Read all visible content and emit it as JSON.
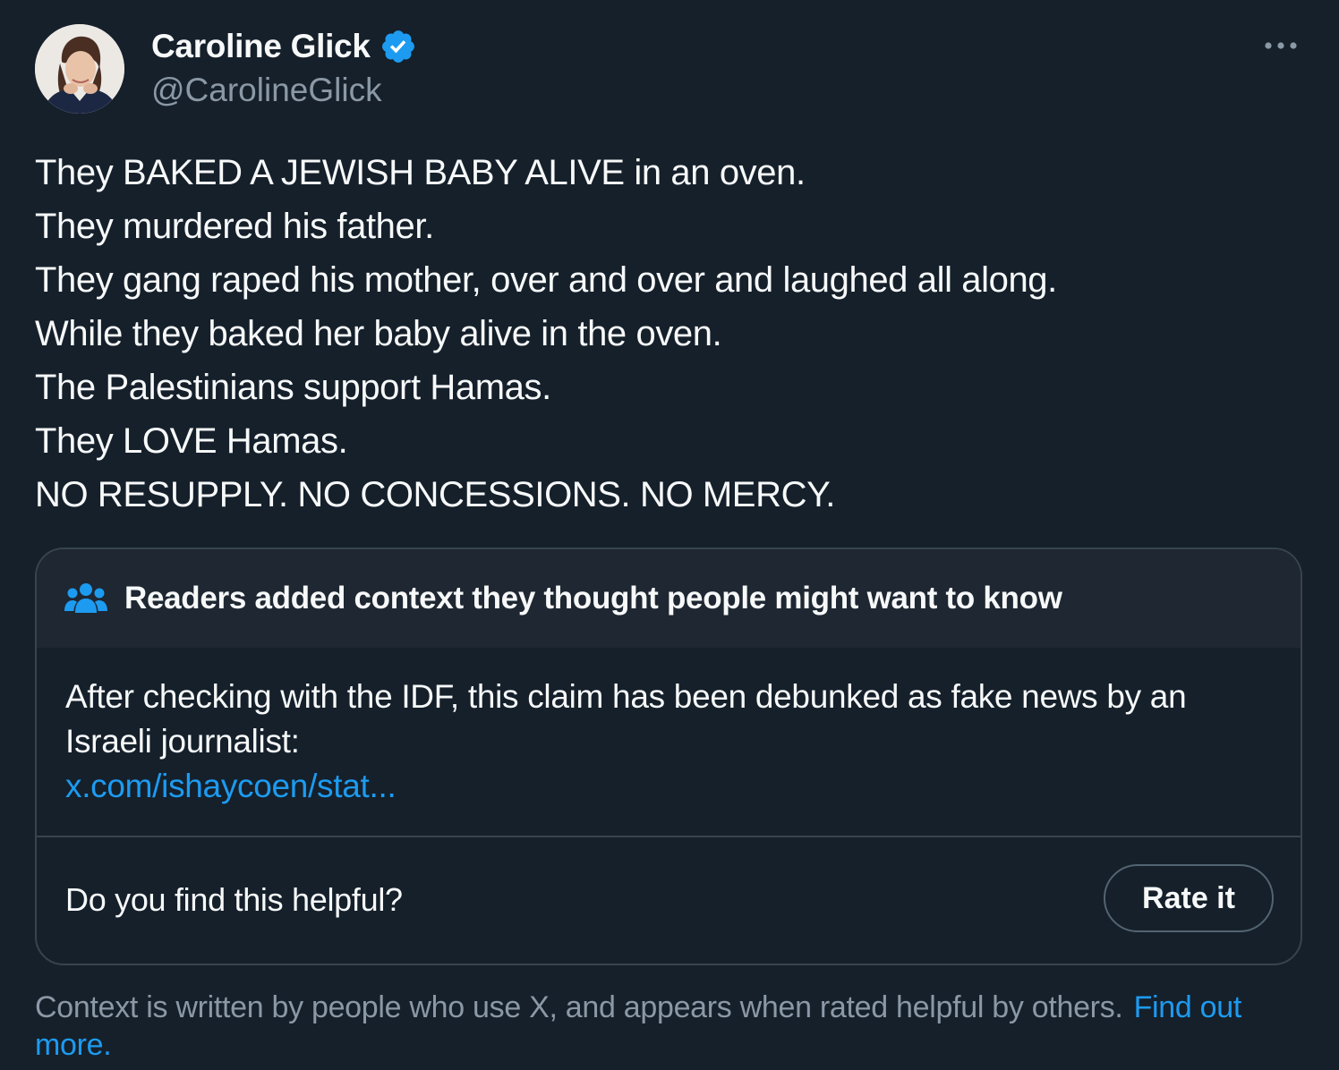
{
  "author": {
    "display_name": "Caroline Glick",
    "handle": "@CarolineGlick",
    "verified": true
  },
  "tweet": {
    "lines": [
      "They BAKED A JEWISH BABY ALIVE in an oven.",
      "They murdered his father.",
      "They gang raped his mother, over and over and laughed all along.",
      "While they baked her baby alive in the oven.",
      "The Palestinians support Hamas.",
      "They LOVE Hamas.",
      "NO RESUPPLY. NO CONCESSIONS. NO MERCY."
    ]
  },
  "community_note": {
    "title": "Readers added context they thought people might want to know",
    "body": "After checking with the IDF, this claim has been debunked as fake news by an Israeli journalist:",
    "link_text": "x.com/ishaycoen/stat...",
    "helpful_question": "Do you find this helpful?",
    "rate_label": "Rate it"
  },
  "disclaimer": {
    "text": "Context is written by people who use X, and appears when rated helpful by others.",
    "link_text": "Find out more."
  },
  "icons": {
    "verified": "verified-badge-icon",
    "more": "more-options-icon",
    "people": "people-icon"
  },
  "colors": {
    "background": "#15202b",
    "accent": "#1d9bf0",
    "muted": "#8b98a5",
    "border": "#38444d",
    "note_header": "#1e2732"
  }
}
